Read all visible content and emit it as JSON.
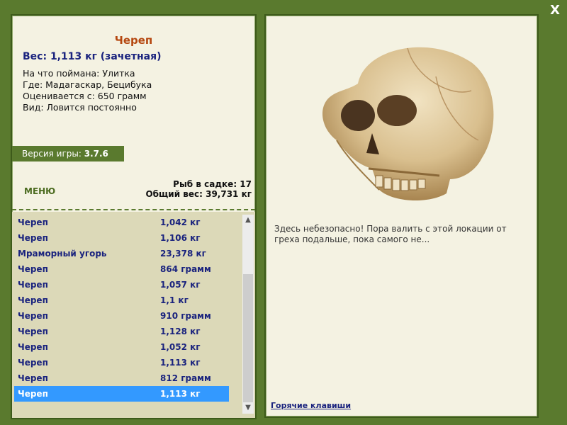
{
  "close_label": "X",
  "fish": {
    "title": "Череп",
    "weight": "Вес: 1,113 кг (зачетная)",
    "info": [
      "На что поймана: Улитка",
      "Где: Мадагаскар, Бецибука",
      "Оценивается с: 650 грамм",
      "Вид: Ловится постоянно"
    ]
  },
  "version": {
    "label": "Версия игры:",
    "value": "3.7.6"
  },
  "menu_label": "МЕНЮ",
  "stats": {
    "fish_in_cage": "Рыб в садке: 17",
    "total_weight": "Общий вес: 39,731 кг"
  },
  "catch_list": [
    {
      "name": "Череп",
      "weight": "1,042 кг"
    },
    {
      "name": "Череп",
      "weight": "1,106 кг"
    },
    {
      "name": "Мраморный угорь",
      "weight": "23,378 кг"
    },
    {
      "name": "Череп",
      "weight": "864 грамм"
    },
    {
      "name": "Череп",
      "weight": "1,057 кг"
    },
    {
      "name": "Череп",
      "weight": "1,1 кг"
    },
    {
      "name": "Череп",
      "weight": "910 грамм"
    },
    {
      "name": "Череп",
      "weight": "1,128 кг"
    },
    {
      "name": "Череп",
      "weight": "1,052 кг"
    },
    {
      "name": "Череп",
      "weight": "1,113 кг"
    },
    {
      "name": "Череп",
      "weight": "812 грамм"
    },
    {
      "name": "Череп",
      "weight": "1,113 кг"
    }
  ],
  "selected_index": 11,
  "description": "Здесь небезопасно! Пора валить с этой локации от греха подальше, пока самого не...",
  "hotkeys_label": "Горячие клавиши",
  "colors": {
    "frame": "#5a7a2e",
    "title": "#b5470f",
    "list_text": "#1a237e",
    "selection": "#3399ff"
  },
  "icons": {
    "close": "close-icon",
    "scroll_up": "chevron-up-icon",
    "scroll_down": "chevron-down-icon"
  }
}
